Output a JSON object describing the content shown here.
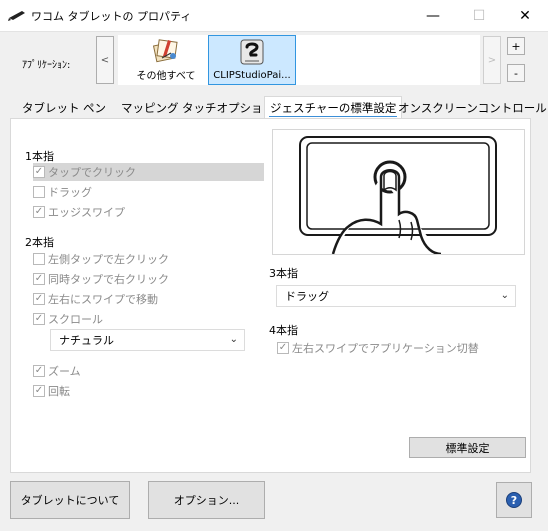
{
  "window": {
    "title": "ワコム タブレットの プロパティ",
    "min_glyph": "—",
    "max_glyph": "☐",
    "close_glyph": "✕"
  },
  "applications": {
    "label": "ｱﾌﾟﾘｹｰｼｮﾝ:",
    "left_arrow": "<",
    "right_arrow": ">",
    "add": "+",
    "remove": "-",
    "items": [
      {
        "label": "その他すべて",
        "icon": "all-apps-icon",
        "selected": false
      },
      {
        "label": "CLIPStudioPai...",
        "icon": "clip-studio-icon",
        "selected": true
      }
    ]
  },
  "tabs": [
    {
      "label": "タブレット",
      "active": false
    },
    {
      "label": "ペン",
      "active": false
    },
    {
      "label": "マッピング",
      "active": false
    },
    {
      "label": "タッチオプション",
      "active": false
    },
    {
      "label": "ジェスチャーの標準設定",
      "active": true
    },
    {
      "label": "オンスクリーンコントロール",
      "active": false
    }
  ],
  "one_finger": {
    "label": "1本指",
    "options": [
      {
        "label": "タップでクリック",
        "checked": true
      },
      {
        "label": "ドラッグ",
        "checked": false
      },
      {
        "label": "エッジスワイプ",
        "checked": true
      }
    ]
  },
  "two_finger": {
    "label": "2本指",
    "options": [
      {
        "label": "左側タップで左クリック",
        "checked": false
      },
      {
        "label": "同時タップで右クリック",
        "checked": true
      },
      {
        "label": "左右にスワイプで移動",
        "checked": true
      },
      {
        "label": "スクロール",
        "checked": true
      }
    ],
    "scroll_direction": "ナチュラル",
    "options_after": [
      {
        "label": "ズーム",
        "checked": true
      },
      {
        "label": "回転",
        "checked": true
      }
    ]
  },
  "three_finger": {
    "label": "3本指",
    "selected": "ドラッグ"
  },
  "four_finger": {
    "label": "4本指",
    "option": {
      "label": "左右スワイプでアプリケーション切替",
      "checked": true
    }
  },
  "buttons": {
    "defaults": "標準設定",
    "about": "タブレットについて",
    "options": "オプション...",
    "help": "?"
  },
  "check_glyph": "✓",
  "chevron_glyph": "⌄",
  "colors": {
    "selection": "#cce8ff",
    "selection_border": "#3296e0",
    "disabled_text": "#8a8a8a",
    "help_blue": "#2a5fb0"
  }
}
